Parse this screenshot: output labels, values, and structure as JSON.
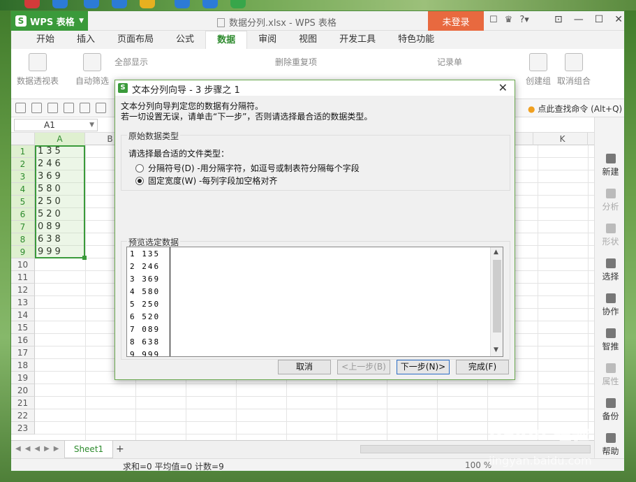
{
  "app": {
    "name": "WPS 表格",
    "doc_title": "数据分列.xlsx - WPS 表格",
    "login_label": "未登录"
  },
  "tabs": [
    "开始",
    "插入",
    "页面布局",
    "公式",
    "数据",
    "审阅",
    "视图",
    "开发工具",
    "特色功能"
  ],
  "active_tab": "数据",
  "ribbon": {
    "pivot": "数据透视表",
    "autofilter": "自动筛选",
    "show_all": "全部显示",
    "remove_dup": "删除重复项",
    "record_sheet": "记录单",
    "create_group": "创建组",
    "ungroup": "取消组合"
  },
  "quick_access": {
    "find_command": "点此查找命令 (Alt+Q)"
  },
  "name_box": "A1",
  "columns": [
    "A",
    "B",
    "K"
  ],
  "rows": [
    "1",
    "2",
    "3",
    "4",
    "5",
    "6",
    "7",
    "8",
    "9",
    "10",
    "11",
    "12",
    "13",
    "14",
    "15",
    "16",
    "17",
    "18",
    "19",
    "20",
    "21",
    "22",
    "23"
  ],
  "cellsA": [
    "135",
    "246",
    "369",
    "580",
    "250",
    "520",
    "089",
    "638",
    "999"
  ],
  "sidebar": [
    "新建",
    "分析",
    "形状",
    "选择",
    "协作",
    "智推",
    "属性",
    "备份",
    "帮助"
  ],
  "sheet": {
    "tab": "Sheet1"
  },
  "status": {
    "stats": "求和=0  平均值=0  计数=9",
    "zoom": "100 %"
  },
  "dialog": {
    "title": "文本分列向导 - 3 步骤之 1",
    "desc1": "文本分列向导判定您的数据有分隔符。",
    "desc2": "若一切设置无误，请单击“下一步”，否则请选择最合适的数据类型。",
    "group_label": "原始数据类型",
    "prompt": "请选择最合适的文件类型：",
    "radio1": "分隔符号(D) -用分隔字符，如逗号或制表符分隔每个字段",
    "radio2": "固定宽度(W) -每列字段加空格对齐",
    "preview_label": "预览选定数据",
    "preview_lines": [
      "1 135",
      "2 246",
      "3 369",
      "4 580",
      "5 250",
      "6 520",
      "7 089",
      "8 638",
      "9 999"
    ],
    "btn_cancel": "取消",
    "btn_prev": "<上一步(B)",
    "btn_next": "下一步(N)>",
    "btn_finish": "完成(F)"
  },
  "watermark": {
    "text": "Baidu 经验",
    "url": "jingyan.baidu.com"
  }
}
